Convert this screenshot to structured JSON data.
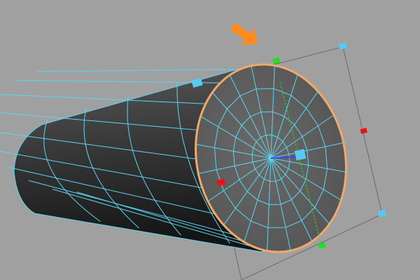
{
  "viewport": {
    "background": "#a0a0a0",
    "wire_color": "#5cd6f2",
    "selection_color": "#f2a868",
    "arrow_color": "#ff8a1e",
    "handle_colors": {
      "scale": "#5ac8f0",
      "green": "#22dd22",
      "red": "#ee1111"
    },
    "radial_segments": 20,
    "rings": 3,
    "icons": [
      "orange-arrow-icon",
      "manipulator-handle-icon"
    ]
  }
}
